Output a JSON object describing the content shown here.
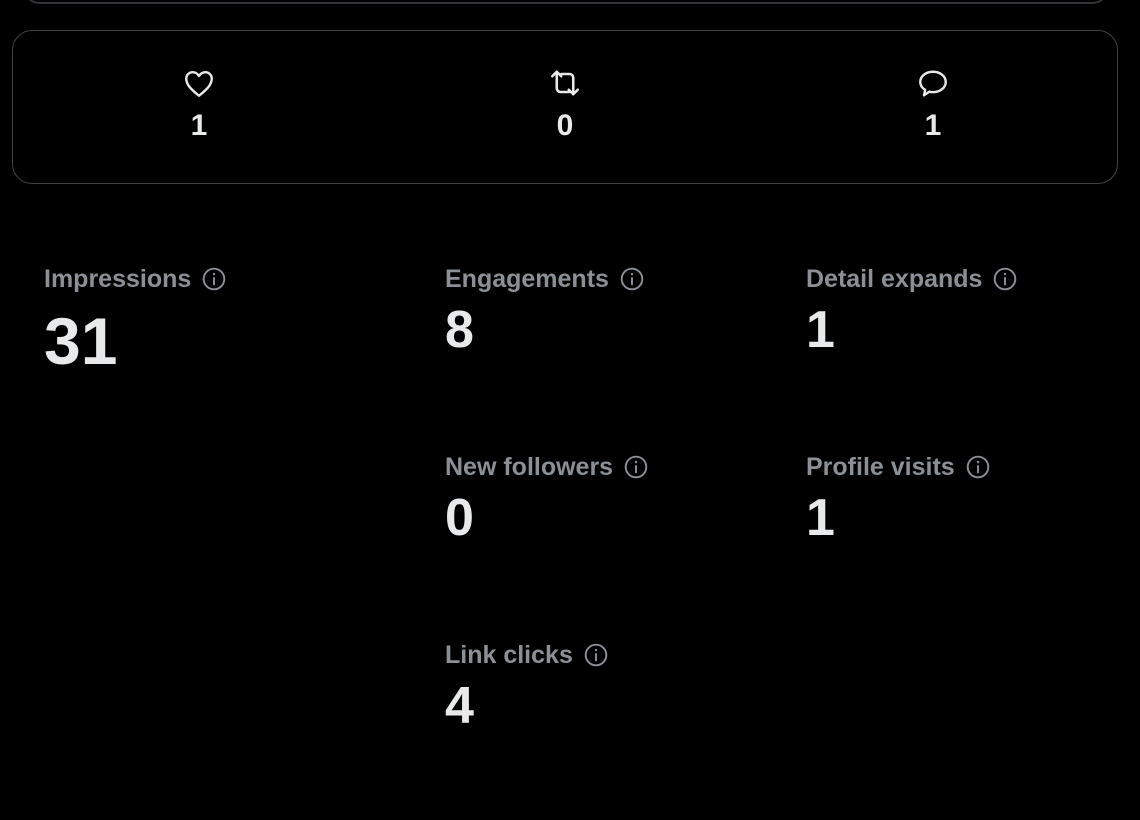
{
  "engagement_bar": {
    "likes": {
      "icon": "heart-icon",
      "count": "1"
    },
    "reposts": {
      "icon": "repost-icon",
      "count": "0"
    },
    "replies": {
      "icon": "reply-bubble-icon",
      "count": "1"
    }
  },
  "metrics": {
    "impressions": {
      "label": "Impressions",
      "value": "31"
    },
    "engagements": {
      "label": "Engagements",
      "value": "8"
    },
    "detail_expands": {
      "label": "Detail expands",
      "value": "1"
    },
    "new_followers": {
      "label": "New followers",
      "value": "0"
    },
    "profile_visits": {
      "label": "Profile visits",
      "value": "1"
    },
    "link_clicks": {
      "label": "Link clicks",
      "value": "4"
    }
  },
  "colors": {
    "background": "#000000",
    "text_primary": "#e7e9ea",
    "text_secondary": "#8b9096",
    "border": "#3e4144"
  }
}
